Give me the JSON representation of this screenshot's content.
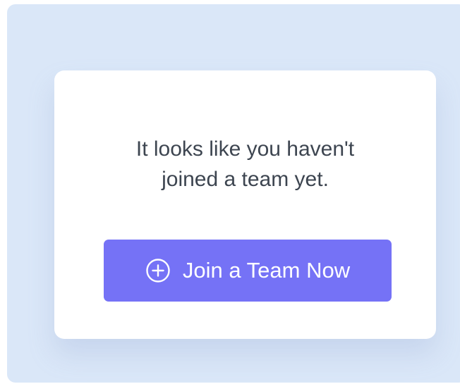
{
  "empty_state": {
    "message_line1": "It looks like you haven't",
    "message_line2": "joined a team yet.",
    "button": {
      "label": "Join a Team Now",
      "icon": "plus-circle-icon"
    }
  },
  "colors": {
    "panel_background": "#dae7f8",
    "card_background": "#ffffff",
    "button_background": "#7572f6",
    "button_text": "#ffffff",
    "message_text": "#3d4550"
  }
}
